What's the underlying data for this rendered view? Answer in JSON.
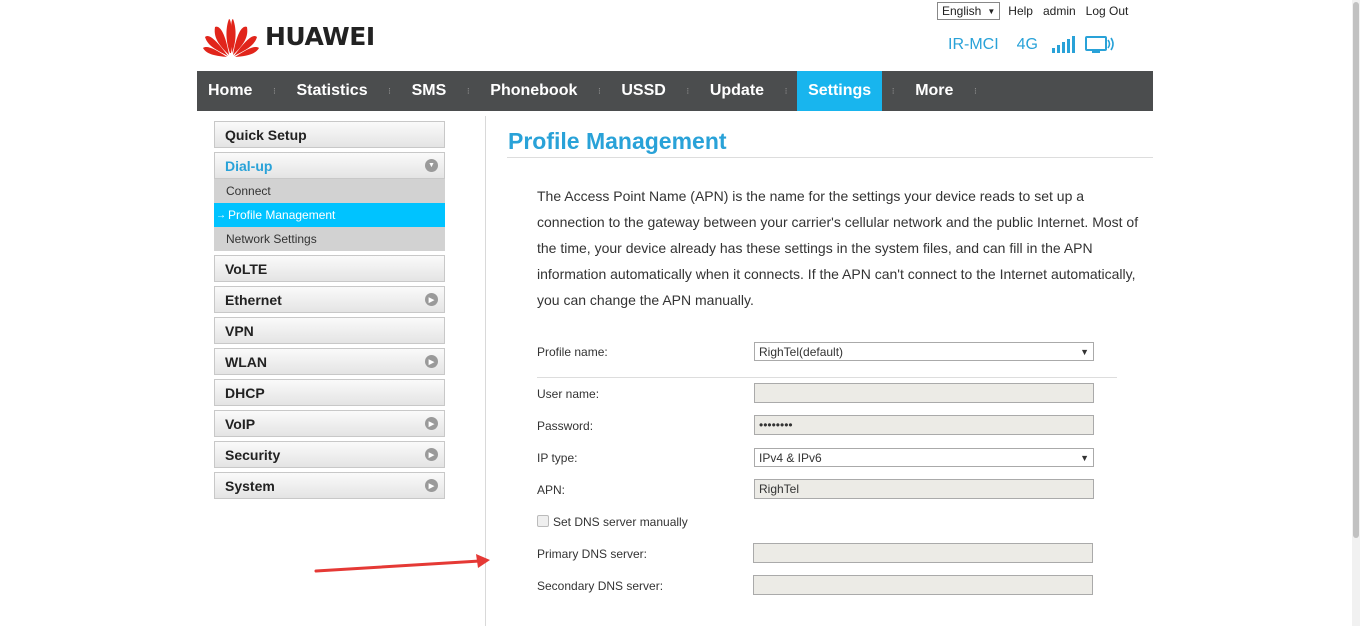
{
  "brand": {
    "name": "HUAWEI"
  },
  "top_links": {
    "language": "English",
    "help": "Help",
    "user": "admin",
    "logout": "Log Out"
  },
  "status": {
    "network": "IR-MCI",
    "type": "4G"
  },
  "nav": [
    "Home",
    "Statistics",
    "SMS",
    "Phonebook",
    "USSD",
    "Update",
    "Settings",
    "More"
  ],
  "sidebar": {
    "quick_setup": "Quick Setup",
    "dialup": "Dial-up",
    "dialup_sub": [
      "Connect",
      "Profile Management",
      "Network Settings"
    ],
    "volte": "VoLTE",
    "ethernet": "Ethernet",
    "vpn": "VPN",
    "wlan": "WLAN",
    "dhcp": "DHCP",
    "voip": "VoIP",
    "security": "Security",
    "system": "System"
  },
  "main": {
    "title": "Profile Management",
    "description": "The Access Point Name (APN) is the name for the settings your device reads to set up a connection to the gateway between your carrier's cellular network and the public Internet. Most of the time, your device already has these settings in the system files, and can fill in the APN information automatically when it connects. If the APN can't connect to the Internet automatically, you can change the APN manually.",
    "form": {
      "profile_name_label": "Profile name:",
      "profile_name_value": "RighTel(default)",
      "username_label": "User name:",
      "username_value": "",
      "password_label": "Password:",
      "password_value": "••••••••",
      "ip_type_label": "IP type:",
      "ip_type_value": "IPv4 & IPv6",
      "apn_label": "APN:",
      "apn_value": "RighTel",
      "dns_manual_label": "Set DNS server manually",
      "primary_dns_label": "Primary DNS server:",
      "primary_dns_value": "",
      "secondary_dns_label": "Secondary DNS server:",
      "secondary_dns_value": ""
    }
  },
  "colors": {
    "accent": "#29a2d8",
    "nav_bg": "#4b4d4e",
    "nav_active": "#18b5ee",
    "sub_active": "#00c3ff",
    "logo_red": "#e1251b",
    "annotation_arrow": "#e53935"
  }
}
